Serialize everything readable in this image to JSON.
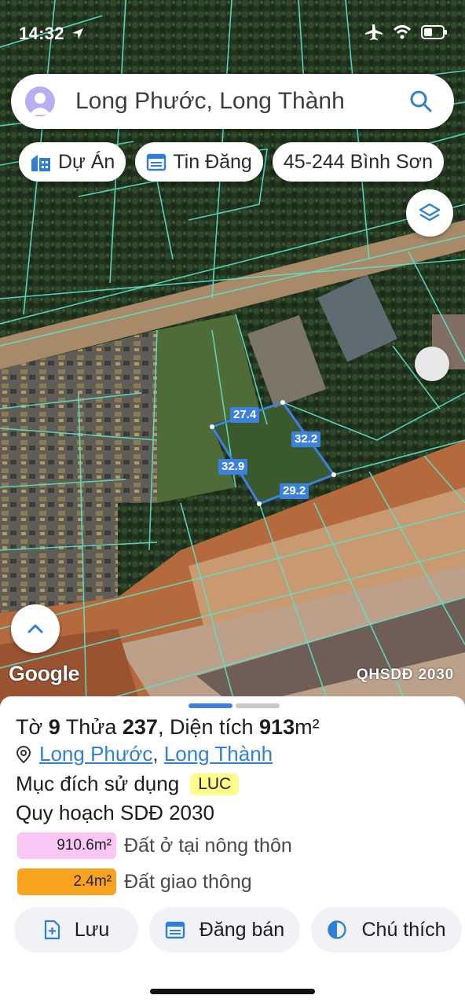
{
  "status_bar": {
    "time": "14:32"
  },
  "search": {
    "query": "Long Phước, Long Thành"
  },
  "chips": [
    {
      "label": "Dự Án",
      "icon": "building-icon"
    },
    {
      "label": "Tin Đăng",
      "icon": "calendar-icon"
    },
    {
      "label": "45-244 Bình Sơn"
    }
  ],
  "map": {
    "parcel_dimensions": [
      "27.4",
      "32.2",
      "32.9",
      "29.2"
    ],
    "google_label": "Google",
    "layer_label": "QHSDĐ 2030"
  },
  "sheet": {
    "title_prefix": "Tờ",
    "sheet_no": "9",
    "parcel_word": "Thửa",
    "parcel_no": "237",
    "area_word": ", Diện tích",
    "area_value": "913",
    "area_unit": "m²",
    "ward": "Long Phước",
    "separator": ",",
    "district": "Long Thành",
    "purpose_label": "Mục đích sử dụng",
    "purpose_code": "LUC",
    "plan_label": "Quy hoạch SDĐ 2030",
    "legend": [
      {
        "value": "910.6m²",
        "label": "Đất ở tại nông thôn",
        "color": "#f9c6f5"
      },
      {
        "value": "2.4m²",
        "label": "Đất giao thông",
        "color": "#f9a21d"
      }
    ],
    "actions": [
      {
        "label": "Lưu",
        "icon": "save-plus-icon"
      },
      {
        "label": "Đăng bán",
        "icon": "calendar-list-icon"
      },
      {
        "label": "Chú thích",
        "icon": "half-circle-icon"
      }
    ]
  },
  "colors": {
    "accent": "#2f7fd6",
    "parcel_line": "#5de0c8",
    "highlight": "#3b82e0"
  }
}
